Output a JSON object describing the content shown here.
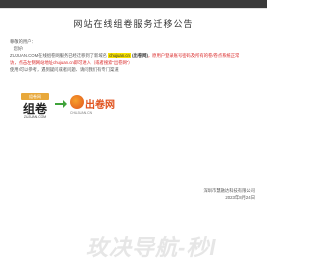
{
  "modal": {
    "title": "网站在线组卷服务迁移公告",
    "lines": [
      "尊敬的用户：",
      "您好!",
      "ZUJUAN.COM在线组卷网服务已经迁移到了",
      "新域名",
      "chujuan.cn",
      "(出卷网)",
      "，原用户登录账号密码及所有的卷/卷点系统正常",
      "访，点击左侧网站地址chujuan.cn即可进入（或者搜索“出卷网”）",
      "使用!可以参考",
      "遇到疑问或者问题、请问我们有专门渠道",
      "我们诚恳地希望用户认可，为您提供更优质、更专业的在线组卷服务，特此公告。",
      "我们会持续改进，为您提供服务，感谢您的支持！"
    ],
    "signature_org": "深圳市慧融达科技有限公司",
    "signature_date": "2023年8月24日"
  },
  "logos": {
    "old_tag": "组卷网",
    "old_name": "组卷",
    "old_url": "ZUJUAN.COM",
    "new_name": "出卷网",
    "new_url": "CHUJUAN.CN"
  },
  "background": {
    "brand_text": "玫决导航-秒l"
  },
  "colors": {
    "accent_red": "#d92323",
    "highlight_yellow": "#f6e100",
    "brand_orange": "#e0521d"
  }
}
